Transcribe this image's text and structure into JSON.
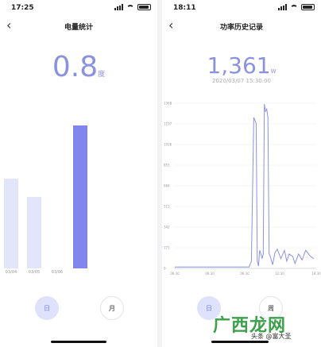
{
  "left": {
    "status_time": "17:25",
    "title": "电量统计",
    "value": "0.8",
    "unit": "度",
    "bars": [
      {
        "label": "03/04",
        "value": 0.5,
        "selected": false
      },
      {
        "label": "03/05",
        "value": 0.4,
        "selected": false
      },
      {
        "label": "03/06",
        "value": 0,
        "selected": false
      },
      {
        "label": "03/07",
        "value": 0.8,
        "selected": true
      }
    ],
    "tabs": [
      {
        "label": "日",
        "active": true
      },
      {
        "label": "月",
        "active": false
      }
    ]
  },
  "right": {
    "status_time": "18:11",
    "title": "功率历史记录",
    "value": "1,361",
    "unit": "W",
    "timestamp": "2020/03/07 15:30:00",
    "tabs": [
      {
        "label": "日",
        "active": true
      },
      {
        "label": "周",
        "active": false
      }
    ]
  },
  "watermark": {
    "big": "广西龙网",
    "small": "头条 @富大圣"
  },
  "colors": {
    "accent": "#8a92e0",
    "bar_faint": "#e3e5fb",
    "bar_active": "#7f86ee",
    "chip_bg": "#dfe2fb"
  },
  "chart_data": {
    "type": "line",
    "title": "",
    "xlabel": "",
    "ylabel": "",
    "x_ticks": [
      "06:30",
      "06:30",
      "06:30",
      "12:30",
      "18:30"
    ],
    "y_ticks": [
      1368,
      1197,
      1026,
      855,
      684,
      513,
      342,
      171,
      0
    ],
    "ylim": [
      0,
      1368
    ],
    "x_hours": [
      6.5,
      7,
      8,
      9,
      10,
      11,
      12,
      12.4,
      12.6,
      12.8,
      13.0,
      13.2,
      13.4,
      13.5,
      13.6,
      13.7,
      13.8,
      13.9,
      14.0,
      14.1,
      14.2,
      14.3,
      14.4,
      14.5,
      14.6,
      14.8,
      15.0,
      15.2,
      15.5,
      15.8,
      16.0,
      16.2,
      16.5,
      16.7,
      17.0,
      17.3,
      17.6,
      18.0,
      18.3
    ],
    "series": [
      {
        "values": [
          12,
          12,
          12,
          12,
          12,
          12,
          12,
          12,
          12,
          12,
          60,
          1250,
          1200,
          60,
          20,
          150,
          120,
          80,
          120,
          1361,
          1300,
          1320,
          1250,
          120,
          100,
          30,
          130,
          160,
          80,
          150,
          60,
          120,
          100,
          40,
          120,
          70,
          150,
          100,
          80
        ]
      }
    ]
  }
}
